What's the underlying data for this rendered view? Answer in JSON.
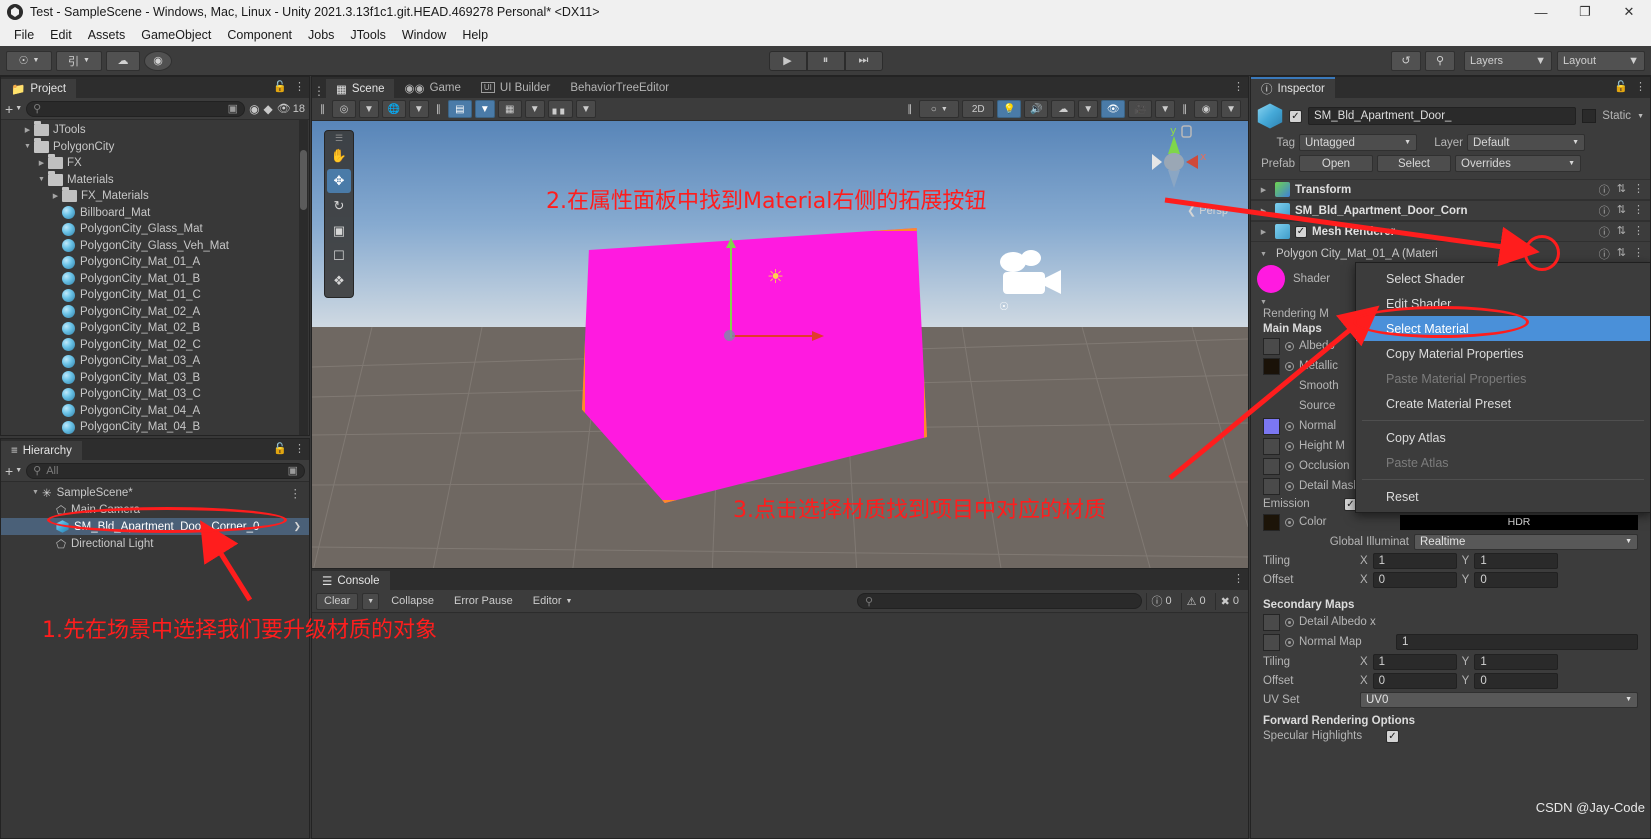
{
  "window": {
    "title": "Test - SampleScene - Windows, Mac, Linux - Unity 2021.3.13f1c1.git.HEAD.469278 Personal* <DX11>",
    "minimize": "—",
    "maximize": "❐",
    "close": "✕"
  },
  "menubar": {
    "items": [
      "File",
      "Edit",
      "Assets",
      "GameObject",
      "Component",
      "Jobs",
      "JTools",
      "Window",
      "Help"
    ]
  },
  "toolbar": {
    "account_icon": "user-icon",
    "cloud_icon": "cloud-icon",
    "collab_icon": "collab-icon",
    "play": "▶",
    "pause": "⏸",
    "step": "⏭",
    "history_icon": "history-icon",
    "search_icon": "search-icon",
    "layers_label": "Layers",
    "layout_label": "Layout"
  },
  "project": {
    "tab": "Project",
    "search_placeholder": "",
    "count_badge": "18",
    "items": [
      {
        "label": "JTools",
        "depth": 1,
        "type": "folder",
        "expanded": false
      },
      {
        "label": "PolygonCity",
        "depth": 1,
        "type": "folder",
        "expanded": true
      },
      {
        "label": "FX",
        "depth": 2,
        "type": "folder",
        "expanded": false
      },
      {
        "label": "Materials",
        "depth": 2,
        "type": "folder",
        "expanded": true
      },
      {
        "label": "FX_Materials",
        "depth": 3,
        "type": "folder",
        "expanded": false
      },
      {
        "label": "Billboard_Mat",
        "depth": 3,
        "type": "material"
      },
      {
        "label": "PolygonCity_Glass_Mat",
        "depth": 3,
        "type": "material"
      },
      {
        "label": "PolygonCity_Glass_Veh_Mat",
        "depth": 3,
        "type": "material"
      },
      {
        "label": "PolygonCity_Mat_01_A",
        "depth": 3,
        "type": "material"
      },
      {
        "label": "PolygonCity_Mat_01_B",
        "depth": 3,
        "type": "material"
      },
      {
        "label": "PolygonCity_Mat_01_C",
        "depth": 3,
        "type": "material"
      },
      {
        "label": "PolygonCity_Mat_02_A",
        "depth": 3,
        "type": "material"
      },
      {
        "label": "PolygonCity_Mat_02_B",
        "depth": 3,
        "type": "material"
      },
      {
        "label": "PolygonCity_Mat_02_C",
        "depth": 3,
        "type": "material"
      },
      {
        "label": "PolygonCity_Mat_03_A",
        "depth": 3,
        "type": "material"
      },
      {
        "label": "PolygonCity_Mat_03_B",
        "depth": 3,
        "type": "material"
      },
      {
        "label": "PolygonCity_Mat_03_C",
        "depth": 3,
        "type": "material"
      },
      {
        "label": "PolygonCity_Mat_04_A",
        "depth": 3,
        "type": "material"
      },
      {
        "label": "PolygonCity_Mat_04_B",
        "depth": 3,
        "type": "material"
      }
    ]
  },
  "hierarchy": {
    "tab": "Hierarchy",
    "search_placeholder": "All",
    "items": [
      {
        "label": "SampleScene*",
        "depth": 1,
        "type": "scene",
        "selected": false
      },
      {
        "label": "Main Camera",
        "depth": 2,
        "type": "gameobject",
        "selected": false
      },
      {
        "label": "SM_Bld_Apartment_Door_Corner_0",
        "depth": 2,
        "type": "prefab",
        "selected": true
      },
      {
        "label": "Directional Light",
        "depth": 2,
        "type": "gameobject",
        "selected": false
      }
    ]
  },
  "scene": {
    "tabs": [
      {
        "label": "Scene",
        "icon": "grid-icon",
        "active": true
      },
      {
        "label": "Game",
        "icon": "gamepad-icon",
        "active": false
      },
      {
        "label": "UI Builder",
        "icon": "ui-icon",
        "active": false
      },
      {
        "label": "BehaviorTreeEditor",
        "icon": "",
        "active": false
      }
    ],
    "toolbar_left": [
      "pivot-toggle",
      "pivot-dropdown",
      "global-toggle",
      "global-dropdown",
      "grid-snap-on",
      "grid-snap-dropdown",
      "grid-visibility",
      "grid-visibility-dropdown",
      "grid-size"
    ],
    "toolbar_right": [
      "shading-mode",
      "2D",
      "lighting-on",
      "audio",
      "fx",
      "fx-dropdown",
      "gizmos-on",
      "camera"
    ],
    "shading_label": "2D",
    "persp_label": "Persp",
    "gizmo_axes": {
      "y": "y",
      "x": "x"
    },
    "tools": [
      "hand-tool",
      "move-tool",
      "rotate-tool",
      "scale-tool",
      "rect-tool",
      "transform-tool",
      "custom-tool"
    ]
  },
  "console": {
    "tab": "Console",
    "clear": "Clear",
    "collapse": "Collapse",
    "error_pause": "Error Pause",
    "editor": "Editor",
    "search_placeholder": "",
    "counts": {
      "log": "0",
      "warn": "0",
      "error": "0"
    }
  },
  "inspector": {
    "tab": "Inspector",
    "object_name": "SM_Bld_Apartment_Door_",
    "static_label": "Static",
    "tag_label": "Tag",
    "tag_value": "Untagged",
    "layer_label": "Layer",
    "layer_value": "Default",
    "prefab_label": "Prefab",
    "prefab_open": "Open",
    "prefab_select": "Select",
    "prefab_overrides": "Overrides",
    "components": [
      {
        "name": "Transform",
        "icon": "transform-icon",
        "checkbox": false
      },
      {
        "name": "SM_Bld_Apartment_Door_Corn",
        "icon": "mesh-filter-icon",
        "checkbox": false
      },
      {
        "name": "Mesh Renderer",
        "icon": "mesh-renderer-icon",
        "checkbox": true
      }
    ],
    "material": {
      "title": "Polygon City_Mat_01_A (Materi",
      "shader_label": "Shader",
      "rendering_mode_label": "Rendering M",
      "main_maps_label": "Main Maps",
      "props": [
        {
          "label": "Albedo",
          "swatch": "#4a4a4a",
          "radio": true
        },
        {
          "label": "Metallic",
          "swatch": "#1a1208",
          "radio": true
        },
        {
          "label": "Smooth",
          "swatch": "",
          "radio": false
        },
        {
          "label": "Source",
          "swatch": "",
          "radio": false
        },
        {
          "label": "Normal",
          "swatch": "#7b77f2",
          "radio": true
        },
        {
          "label": "Height M",
          "swatch": "#4a4a4a",
          "radio": true
        },
        {
          "label": "Occlusion",
          "swatch": "#4a4a4a",
          "radio": true
        },
        {
          "label": "Detail Mask",
          "swatch": "#4a4a4a",
          "radio": true
        }
      ],
      "emission_label": "Emission",
      "emission_checked": true,
      "color_label": "Color",
      "hdr_label": "HDR",
      "gi_label": "Global Illuminat",
      "gi_value": "Realtime",
      "tiling_label": "Tiling",
      "offset_label": "Offset",
      "x_label": "X",
      "y_label": "Y",
      "tiling_x": "1",
      "tiling_y": "1",
      "offset_x": "0",
      "offset_y": "0",
      "secondary_maps_label": "Secondary Maps",
      "detail_albedo_label": "Detail Albedo x",
      "normal_map_label": "Normal Map",
      "normal_map_value": "1",
      "tiling2_x": "1",
      "tiling2_y": "1",
      "offset2_x": "0",
      "offset2_y": "0",
      "uv_set_label": "UV Set",
      "uv_set_value": "UV0",
      "forward_label": "Forward Rendering Options",
      "specular_label": "Specular Highlights"
    }
  },
  "context_menu": {
    "items": [
      {
        "label": "Select Shader",
        "state": "normal"
      },
      {
        "label": "Edit Shader...",
        "state": "normal"
      },
      {
        "label": "Select Material",
        "state": "selected"
      },
      {
        "label": "Copy Material Properties",
        "state": "normal"
      },
      {
        "label": "Paste Material Properties",
        "state": "disabled"
      },
      {
        "label": "Create Material Preset",
        "state": "normal"
      },
      {
        "label": "__sep__",
        "state": "sep"
      },
      {
        "label": "Copy Atlas",
        "state": "normal"
      },
      {
        "label": "Paste Atlas",
        "state": "disabled"
      },
      {
        "label": "__sep__",
        "state": "sep"
      },
      {
        "label": "Reset",
        "state": "normal"
      }
    ]
  },
  "annotations": {
    "step1": "1.先在场景中选择我们要升级材质的对象",
    "step2": "2.在属性面板中找到Material右侧的拓展按钮",
    "step3": "3.点击选择材质找到项目中对应的材质",
    "watermark": "CSDN @Jay-Code",
    "color": "#ff1d1d"
  }
}
